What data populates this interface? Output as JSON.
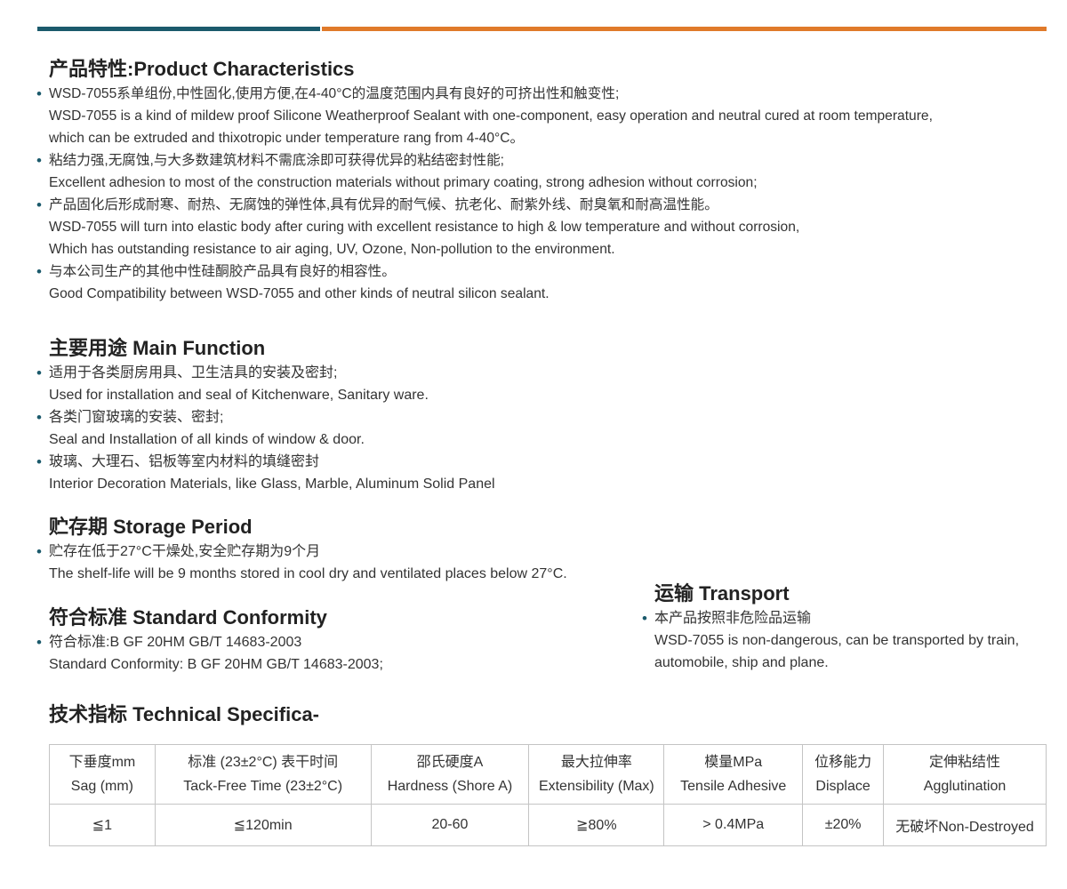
{
  "sections": {
    "characteristics": {
      "heading": "产品特性:Product Characteristics",
      "items": [
        {
          "lines": [
            "WSD-7055系单组份,中性固化,使用方便,在4-40°C的温度范围内具有良好的可挤出性和触变性;",
            "WSD-7055 is a kind of mildew proof Silicone Weatherproof Sealant with one-component, easy operation and neutral cured at room temperature,",
            "which can be extruded and thixotropic under temperature rang from 4-40°C。"
          ]
        },
        {
          "lines": [
            "粘结力强,无腐蚀,与大多数建筑材料不需底涂即可获得优异的粘结密封性能;",
            "Excellent adhesion to most of the construction materials without primary coating, strong adhesion without corrosion;"
          ]
        },
        {
          "lines": [
            "产品固化后形成耐寒、耐热、无腐蚀的弹性体,具有优异的耐气候、抗老化、耐紫外线、耐臭氧和耐高温性能。",
            "WSD-7055 will turn into elastic body after curing with excellent resistance to high & low temperature and without corrosion,",
            "Which has outstanding resistance to air aging, UV, Ozone, Non-pollution to the environment."
          ]
        },
        {
          "lines": [
            "与本公司生产的其他中性硅酮胶产品具有良好的相容性。",
            "Good Compatibility between WSD-7055 and other kinds of neutral silicon sealant."
          ]
        }
      ]
    },
    "function": {
      "heading": "主要用途 Main Function",
      "items": [
        {
          "lines": [
            "适用于各类厨房用具、卫生洁具的安装及密封;",
            "Used for installation and seal of Kitchenware, Sanitary ware."
          ]
        },
        {
          "lines": [
            "各类门窗玻璃的安装、密封;",
            "Seal and Installation of all kinds of window & door."
          ]
        },
        {
          "lines": [
            "玻璃、大理石、铝板等室内材料的填缝密封",
            "Interior Decoration Materials, like Glass, Marble, Aluminum Solid Panel"
          ]
        }
      ]
    },
    "storage": {
      "heading": "贮存期 Storage Period",
      "items": [
        {
          "lines": [
            "贮存在低于27°C干燥处,安全贮存期为9个月",
            "The shelf-life will be 9 months stored in cool dry and ventilated places below 27°C."
          ]
        }
      ]
    },
    "standard": {
      "heading": "符合标准 Standard Conformity",
      "items": [
        {
          "lines": [
            "符合标准:B GF 20HM GB/T 14683-2003",
            "Standard Conformity: B GF 20HM GB/T 14683-2003;"
          ]
        }
      ]
    },
    "transport": {
      "heading": "运输 Transport",
      "items": [
        {
          "lines": [
            "本产品按照非危险品运输",
            "WSD-7055 is non-dangerous, can be transported by train,",
            "automobile, ship and plane."
          ]
        }
      ]
    },
    "technical": {
      "heading": "技术指标 Technical Specifica-"
    }
  },
  "table": {
    "columns": [
      {
        "zh": "下垂度mm",
        "en": "Sag (mm)"
      },
      {
        "zh": "标准 (23±2°C) 表干时间",
        "en": "Tack-Free Time (23±2°C)"
      },
      {
        "zh": "邵氏硬度A",
        "en": "Hardness (Shore A)"
      },
      {
        "zh": "最大拉伸率",
        "en": "Extensibility (Max)"
      },
      {
        "zh": "模量MPa",
        "en": "Tensile Adhesive"
      },
      {
        "zh": "位移能力",
        "en": "Displace"
      },
      {
        "zh": "定伸粘结性",
        "en": "Agglutination"
      }
    ],
    "row": [
      "≦1",
      "≦120min",
      "20-60",
      "≧80%",
      "> 0.4MPa",
      "±20%",
      "无破坏Non-Destroyed"
    ]
  },
  "colors": {
    "accent_teal": "#1b5a6c",
    "accent_orange": "#e07a2a",
    "bullet": "#1b5a6c"
  }
}
